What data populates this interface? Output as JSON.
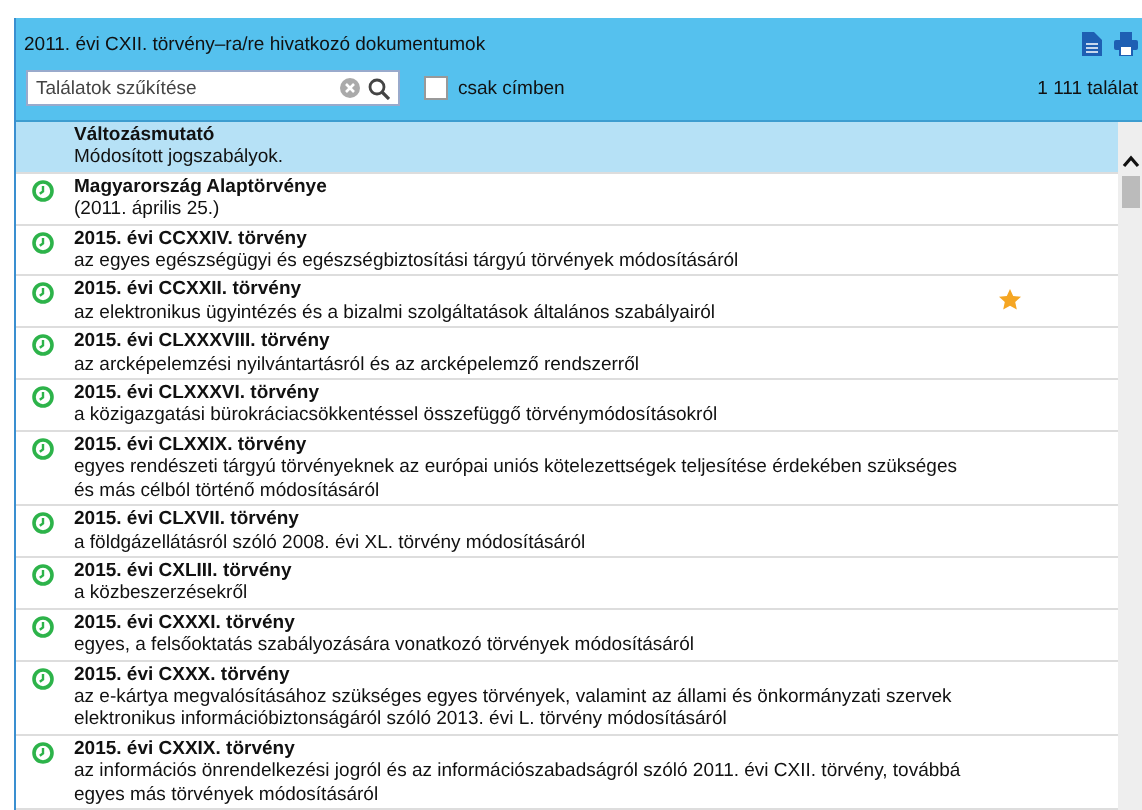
{
  "window": {
    "title": "2011. évi CXII. törvény–ra/re hivatkozó dokumentumok"
  },
  "search": {
    "placeholder": "Találatok szűkítése"
  },
  "title_only": {
    "label": "csak címben",
    "checked": false
  },
  "result_count": "1 111 találat",
  "items": [
    {
      "kind": "summary",
      "title": "Változásmutató",
      "subtitle": "Módosított jogszabályok.",
      "selected": true,
      "starred": false
    },
    {
      "kind": "law",
      "title": "Magyarország Alaptörvénye",
      "subtitle": "(2011. április 25.)",
      "selected": false,
      "starred": false
    },
    {
      "kind": "law",
      "title": "2015. évi CCXXIV. törvény",
      "subtitle": "az egyes egészségügyi és egészségbiztosítási tárgyú törvények módosításáról",
      "selected": false,
      "starred": false
    },
    {
      "kind": "law",
      "title": "2015. évi CCXXII. törvény",
      "subtitle": "az elektronikus ügyintézés és a bizalmi szolgáltatások általános szabályairól",
      "selected": false,
      "starred": true
    },
    {
      "kind": "law",
      "title": "2015. évi CLXXXVIII. törvény",
      "subtitle": "az arcképelemzési nyilvántartásról és az arcképelemző rendszerről",
      "selected": false,
      "starred": false
    },
    {
      "kind": "law",
      "title": "2015. évi CLXXXVI. törvény",
      "subtitle": "a közigazgatási bürokráciacsökkentéssel összefüggő törvénymódosításokról",
      "selected": false,
      "starred": false
    },
    {
      "kind": "law",
      "title": "2015. évi CLXXIX. törvény",
      "subtitle": "egyes rendészeti tárgyú törvényeknek az európai uniós kötelezettségek teljesítése érdekében szükséges és más célból történő módosításáról",
      "selected": false,
      "starred": false
    },
    {
      "kind": "law",
      "title": "2015. évi CLXVII. törvény",
      "subtitle": "a földgázellátásról szóló 2008. évi XL. törvény módosításáról",
      "selected": false,
      "starred": false
    },
    {
      "kind": "law",
      "title": "2015. évi CXLIII. törvény",
      "subtitle": "a közbeszerzésekről",
      "selected": false,
      "starred": false
    },
    {
      "kind": "law",
      "title": "2015. évi CXXXI. törvény",
      "subtitle": "egyes, a felsőoktatás szabályozására vonatkozó törvények módosításáról",
      "selected": false,
      "starred": false
    },
    {
      "kind": "law",
      "title": "2015. évi CXXX. törvény",
      "subtitle": "az e-kártya megvalósításához szükséges egyes törvények, valamint az állami és önkormányzati szervek elektronikus információbiztonságáról szóló 2013. évi L. törvény módosításáról",
      "selected": false,
      "starred": false
    },
    {
      "kind": "law",
      "title": "2015. évi CXXIX. törvény",
      "subtitle": "az információs önrendelkezési jogról és az információszabadságról szóló 2011. évi CXII. törvény, továbbá egyes más törvények módosításáról",
      "selected": false,
      "starred": false
    }
  ]
}
